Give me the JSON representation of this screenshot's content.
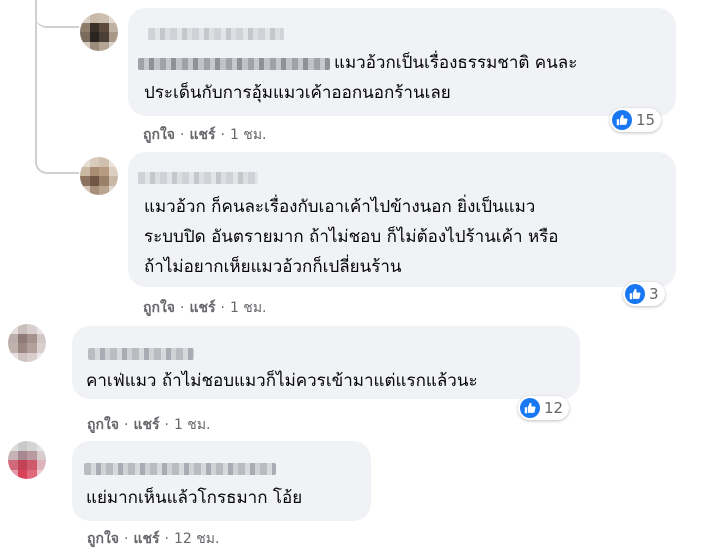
{
  "comments": [
    {
      "text_lines": [
        "แมวอ้วกเป็นเรื่องธรรมชาติ คนละ",
        "ประเด็นกับการอุ้มแมวเค้าออกนอกร้านเลย"
      ],
      "like_label": "ถูกใจ",
      "reply_label": "แชร์",
      "time": "1 ชม.",
      "reaction_count": "15"
    },
    {
      "text_lines": [
        "แมวอ้วก ก็คนละเรื่องกับเอาเค้าไปข้างนอก ยิ่งเป็นแมว",
        "ระบบปิด อันตรายมาก ถ้าไม่ชอบ ก็ไม่ต้องไปร้านเค้า หรือ",
        "ถ้าไม่อยากเห็ยแมวอ้วกก็เปลี่ยนร้าน"
      ],
      "like_label": "ถูกใจ",
      "reply_label": "แชร์",
      "time": "1 ชม.",
      "reaction_count": "3"
    },
    {
      "text_lines": [
        "คาเฟ่แมว ถ้าไม่ชอบแมวก็ไม่ควรเข้ามาแต่แรกแล้วนะ"
      ],
      "like_label": "ถูกใจ",
      "reply_label": "แชร์",
      "time": "1 ชม.",
      "reaction_count": "12"
    },
    {
      "text_lines": [
        "แย่มากเห็นแล้วโกรธมาก โอ้ย"
      ],
      "like_label": "ถูกใจ",
      "reply_label": "แชร์",
      "time": "12 ชม.",
      "reaction_count": ""
    }
  ],
  "separator": "·",
  "reaction_icon": "like-icon",
  "colors": {
    "accent": "#1877f2",
    "bubble": "#f0f2f5",
    "meta": "#65676b",
    "text": "#050505"
  }
}
